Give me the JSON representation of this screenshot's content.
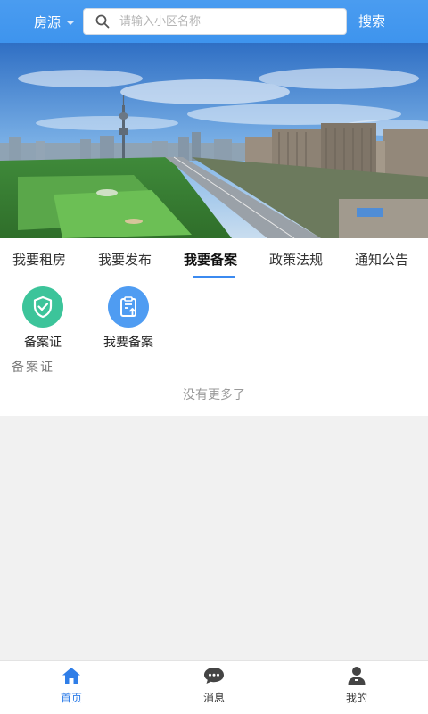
{
  "topbar": {
    "city_label": "房源",
    "search_placeholder": "请输入小区名称",
    "search_button": "搜索"
  },
  "tabs": [
    {
      "label": "我要租房"
    },
    {
      "label": "我要发布"
    },
    {
      "label": "我要备案",
      "active": true
    },
    {
      "label": "政策法规"
    },
    {
      "label": "通知公告"
    }
  ],
  "shortcuts": [
    {
      "label": "备案证",
      "icon": "shield-check-icon",
      "color": "#3cc49a"
    },
    {
      "label": "我要备案",
      "icon": "clipboard-upload-icon",
      "color": "#4f9cf2"
    }
  ],
  "section": {
    "title": "备案证",
    "empty_text": "没有更多了"
  },
  "bottom_nav": [
    {
      "label": "首页",
      "icon": "home-icon",
      "active": true
    },
    {
      "label": "消息",
      "icon": "chat-icon"
    },
    {
      "label": "我的",
      "icon": "user-icon"
    }
  ],
  "colors": {
    "accent": "#3e94ee",
    "active_tab_underline": "#3b8af0",
    "nav_active": "#2f7ee8"
  }
}
